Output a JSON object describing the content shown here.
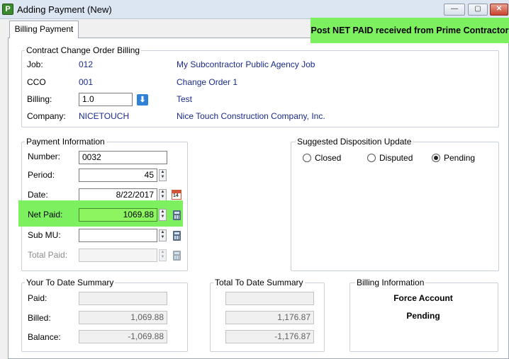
{
  "window": {
    "icon_letter": "P",
    "title": "Adding Payment  (New)",
    "minimize": "—",
    "maximize": "▢",
    "close": "✕"
  },
  "tabs": [
    {
      "label": "Billing Payment"
    }
  ],
  "annotation": "Post NET PAID received from Prime Contractor",
  "cco_billing": {
    "title": "Contract Change Order Billing",
    "job_label": "Job:",
    "job_code": "012",
    "job_name": "My Subcontractor Public Agency Job",
    "cco_label": "CCO",
    "cco_code": "001",
    "cco_name": "Change Order 1",
    "billing_label": "Billing:",
    "billing_value": "1.0",
    "billing_desc": "Test",
    "company_label": "Company:",
    "company_code": "NICETOUCH",
    "company_name": "Nice Touch Construction Company, Inc."
  },
  "payment_info": {
    "title": "Payment Information",
    "number_label": "Number:",
    "number_value": "0032",
    "period_label": "Period:",
    "period_value": "45",
    "date_label": "Date:",
    "date_value": "8/22/2017",
    "calendar_day": "14",
    "net_paid_label": "Net Paid:",
    "net_paid_value": "1069.88",
    "sub_mu_label": "Sub MU:",
    "sub_mu_value": "",
    "total_paid_label": "Total Paid:",
    "total_paid_value": ""
  },
  "disposition": {
    "title": "Suggested Disposition Update",
    "options": [
      {
        "label": "Closed",
        "selected": false
      },
      {
        "label": "Disputed",
        "selected": false
      },
      {
        "label": "Pending",
        "selected": true
      }
    ]
  },
  "your_to_date": {
    "title": "Your To Date Summary",
    "paid_label": "Paid:",
    "paid_value": "",
    "billed_label": "Billed:",
    "billed_value": "1,069.88",
    "balance_label": "Balance:",
    "balance_value": "-1,069.88"
  },
  "total_to_date": {
    "title": "Total To Date Summary",
    "paid_value": "",
    "billed_value": "1,176.87",
    "balance_value": "-1,176.87"
  },
  "billing_information": {
    "title": "Billing Information",
    "line1": "Force Account",
    "line2": "Pending"
  },
  "colors": {
    "highlight": "#7df060",
    "link_text": "#1a2a8a"
  }
}
